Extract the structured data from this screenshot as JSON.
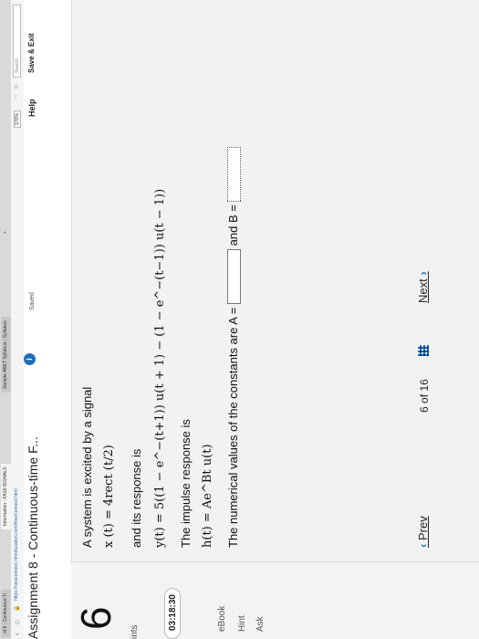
{
  "browser": {
    "tabs": [
      "nt 8 - Continuous-Ti",
      "Information - FA18-SIGNALS",
      "Sample ABET Syllabus - Syllabus"
    ],
    "url": "https://newconnect.mheducation.com/flow/connect.html",
    "zoom": "170%",
    "search_placeholder": "Search"
  },
  "header": {
    "title": "Assignment 8 - Continuous-time F...",
    "info_label": "i",
    "saved": "Saved",
    "help": "Help",
    "save_exit": "Save & Exit"
  },
  "sidebar": {
    "question_number": "6",
    "points_label": "ints",
    "timer": "03:18:30",
    "ebook": "eBook",
    "hint": "Hint",
    "ask": "Ask"
  },
  "question": {
    "intro": "A system is excited by a signal",
    "x_eq": "x (t)  =  4rect (t/2)",
    "response_intro": "and its response is",
    "y_eq": "y(t)  =  5((1 − e^−(t+1)) u(t + 1) − (1 − e^−(t−1)) u(t − 1))",
    "impulse_intro": "The impulse response is",
    "h_eq": "h(t)  =  Ae^Bt u(t)",
    "constants_prefix": "The numerical values of the constants are A =",
    "and_b": "and B ="
  },
  "footer": {
    "prev": "Prev",
    "current": "6",
    "of": "of",
    "total": "16",
    "next": "Next"
  }
}
